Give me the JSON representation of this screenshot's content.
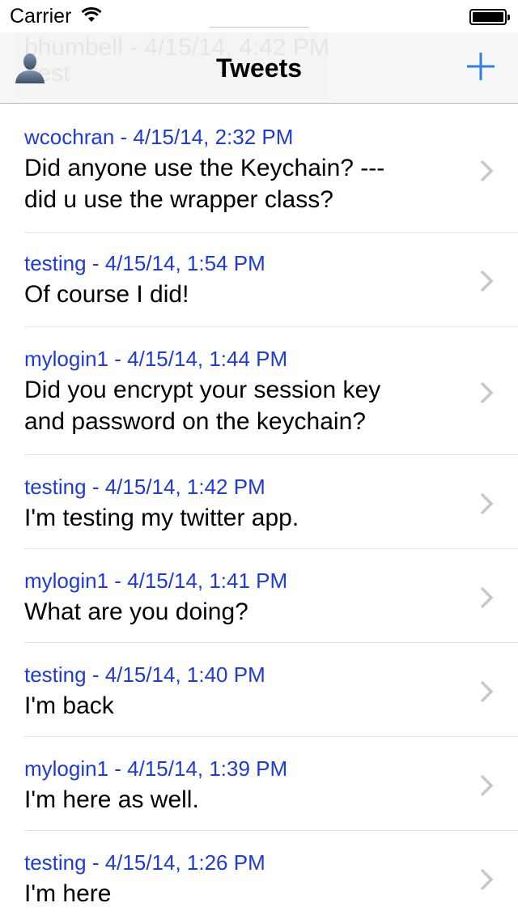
{
  "status_bar": {
    "carrier": "Carrier",
    "wifi_icon": "wifi-icon",
    "battery_icon": "battery-icon"
  },
  "nav": {
    "title": "Tweets",
    "left_icon": "person-icon",
    "right_icon": "plus-icon",
    "ghost_text_1": "bhumbell - 4/15/14, 4:42 PM",
    "ghost_text_2": "test"
  },
  "colors": {
    "meta_blue": "#1f3bd6",
    "tint_blue": "#2f7ee0",
    "chevron": "#c7c7cc"
  },
  "tweets": [
    {
      "meta": "wcochran - 4/15/14, 2:32 PM",
      "lines": [
        "Did anyone use the Keychain? ---",
        "did u use the wrapper class?"
      ]
    },
    {
      "meta": "testing - 4/15/14, 1:54 PM",
      "lines": [
        "Of course I did!"
      ]
    },
    {
      "meta": "mylogin1 - 4/15/14, 1:44 PM",
      "lines": [
        "Did you encrypt your session key",
        "and password on the keychain?"
      ]
    },
    {
      "meta": "testing - 4/15/14, 1:42 PM",
      "lines": [
        "I'm testing my twitter app."
      ]
    },
    {
      "meta": "mylogin1 - 4/15/14, 1:41 PM",
      "lines": [
        "What are you doing?"
      ]
    },
    {
      "meta": "testing - 4/15/14, 1:40 PM",
      "lines": [
        "I'm back"
      ]
    },
    {
      "meta": "mylogin1 - 4/15/14, 1:39 PM",
      "lines": [
        "I'm here as well."
      ]
    },
    {
      "meta": "testing - 4/15/14, 1:26 PM",
      "lines": [
        "I'm here"
      ]
    }
  ]
}
